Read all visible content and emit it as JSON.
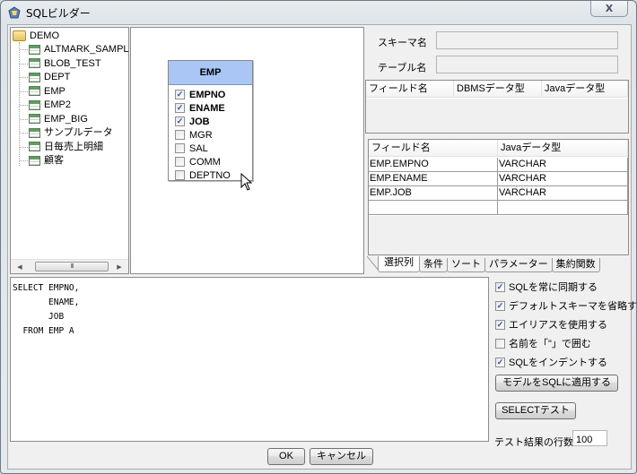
{
  "window": {
    "title": "SQLビルダー",
    "close_label": "X"
  },
  "tree": {
    "root": "DEMO",
    "items": [
      {
        "label": "ALTMARK_SAMPLE"
      },
      {
        "label": "BLOB_TEST"
      },
      {
        "label": "DEPT"
      },
      {
        "label": "EMP"
      },
      {
        "label": "EMP2"
      },
      {
        "label": "EMP_BIG"
      },
      {
        "label": "サンプルデータ"
      },
      {
        "label": "日毎売上明細"
      },
      {
        "label": "顧客"
      }
    ],
    "scroll": {
      "thumb_grip": "III",
      "left_arrow": "◀",
      "right_arrow": "▶"
    }
  },
  "diagram": {
    "entity": {
      "name": "EMP",
      "columns": [
        {
          "name": "EMPNO",
          "checked": true
        },
        {
          "name": "ENAME",
          "checked": true
        },
        {
          "name": "JOB",
          "checked": true
        },
        {
          "name": "MGR",
          "checked": false
        },
        {
          "name": "SAL",
          "checked": false
        },
        {
          "name": "COMM",
          "checked": false
        },
        {
          "name": "DEPTNO",
          "checked": false
        }
      ]
    }
  },
  "properties": {
    "schema_label": "スキーマ名",
    "schema_value": "",
    "table_label": "テーブル名",
    "table_value": "",
    "field_grid": {
      "headers": [
        "フィールド名",
        "DBMSデータ型",
        "Javaデータ型"
      ],
      "rows": []
    }
  },
  "selected_columns": {
    "headers": [
      "フィールド名",
      "Javaデータ型"
    ],
    "rows": [
      [
        "EMP.EMPNO",
        "VARCHAR"
      ],
      [
        "EMP.ENAME",
        "VARCHAR"
      ],
      [
        "EMP.JOB",
        "VARCHAR"
      ],
      [
        "",
        ""
      ]
    ]
  },
  "tabs": [
    {
      "label": "選択列",
      "active": true
    },
    {
      "label": "条件",
      "active": false
    },
    {
      "label": "ソート",
      "active": false
    },
    {
      "label": "パラメーター",
      "active": false
    },
    {
      "label": "集約関数",
      "active": false
    }
  ],
  "sql": {
    "text": "SELECT EMPNO,\n       ENAME,\n       JOB\n  FROM EMP A"
  },
  "options": [
    {
      "label": "SQLを常に同期する",
      "checked": true
    },
    {
      "label": "デフォルトスキーマを省略する",
      "checked": true
    },
    {
      "label": "エイリアスを使用する",
      "checked": true
    },
    {
      "label": "名前を「\"」で囲む",
      "checked": false
    },
    {
      "label": "SQLをインデントする",
      "checked": true
    }
  ],
  "buttons": {
    "apply_model": "モデルをSQLに適用する",
    "select_test": "SELECTテスト",
    "ok": "OK",
    "cancel": "キャンセル"
  },
  "test_rows": {
    "label": "テスト結果の行数",
    "value": "100"
  },
  "colors": {
    "entity_header": "#a9c6f4",
    "check_mark": "#2a4fb0"
  }
}
